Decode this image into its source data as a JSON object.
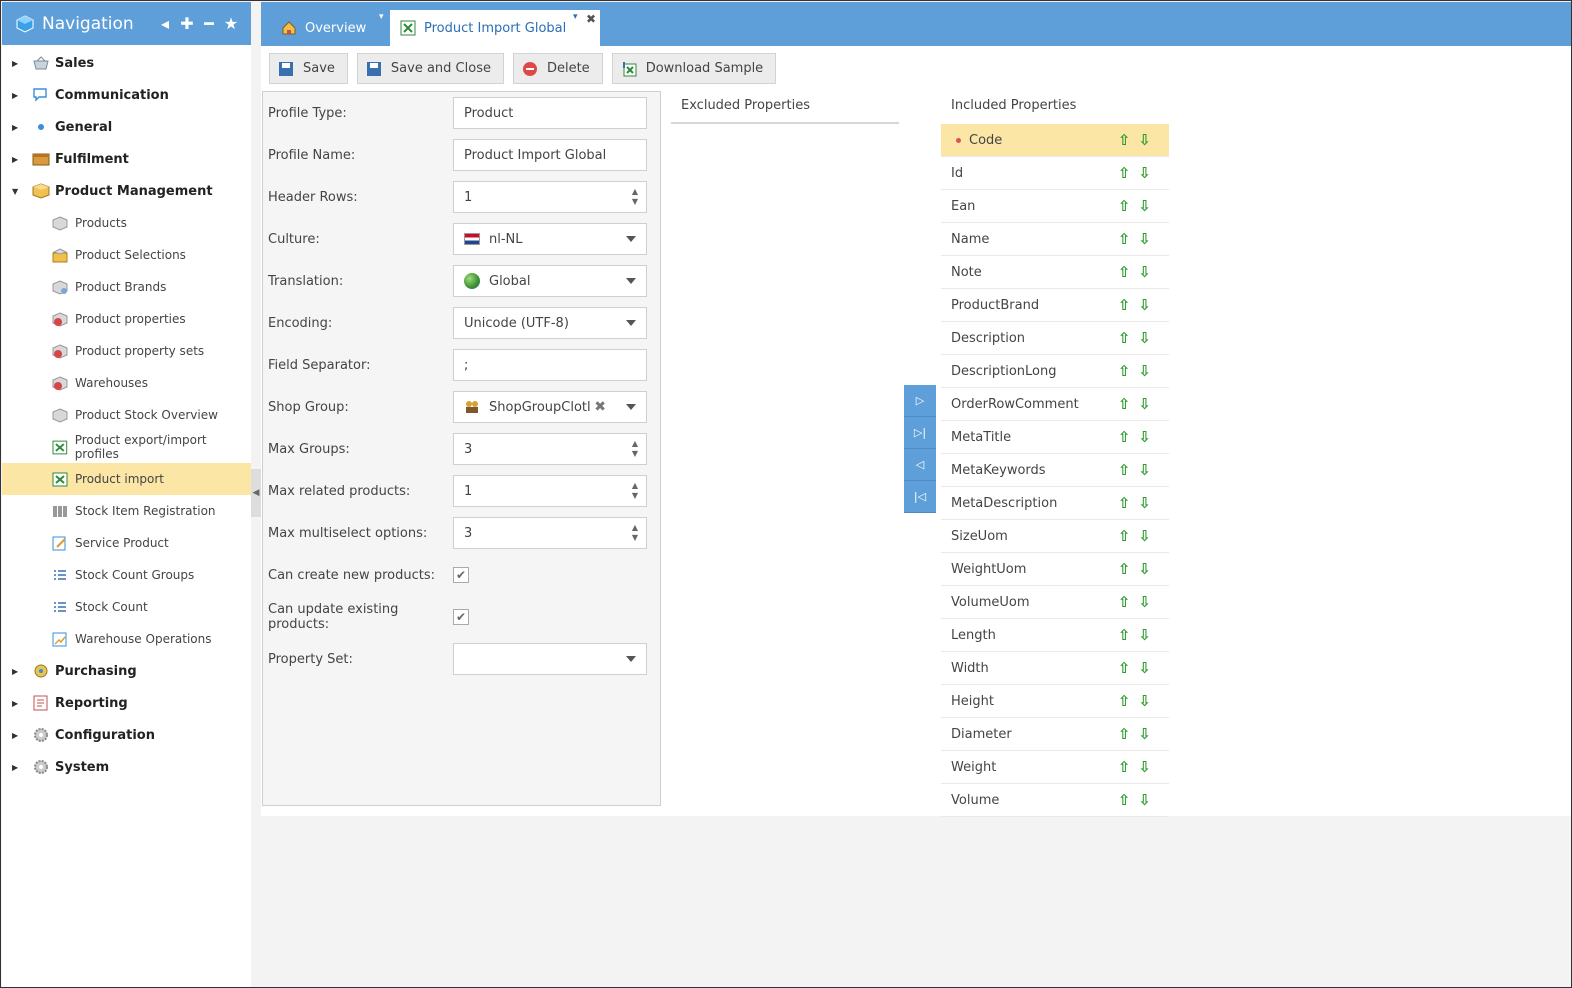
{
  "navigation": {
    "title": "Navigation",
    "groups": [
      {
        "label": "Sales",
        "expanded": false,
        "icon": "basket-icon"
      },
      {
        "label": "Communication",
        "expanded": false,
        "icon": "chat-icon"
      },
      {
        "label": "General",
        "expanded": false,
        "icon": "dot-icon"
      },
      {
        "label": "Fulfilment",
        "expanded": false,
        "icon": "box-icon"
      },
      {
        "label": "Product Management",
        "expanded": true,
        "icon": "package-icon"
      },
      {
        "label": "Purchasing",
        "expanded": false,
        "icon": "purchase-icon"
      },
      {
        "label": "Reporting",
        "expanded": false,
        "icon": "report-icon"
      },
      {
        "label": "Configuration",
        "expanded": false,
        "icon": "gear-icon"
      },
      {
        "label": "System",
        "expanded": false,
        "icon": "gear-icon"
      }
    ],
    "product_management_items": [
      {
        "label": "Products"
      },
      {
        "label": "Product Selections"
      },
      {
        "label": "Product Brands"
      },
      {
        "label": "Product properties"
      },
      {
        "label": "Product property sets"
      },
      {
        "label": "Warehouses"
      },
      {
        "label": "Product Stock Overview"
      },
      {
        "label": "Product export/import profiles"
      },
      {
        "label": "Product import",
        "active": true
      },
      {
        "label": "Stock Item Registration"
      },
      {
        "label": "Service Product"
      },
      {
        "label": "Stock Count Groups"
      },
      {
        "label": "Stock Count"
      },
      {
        "label": "Warehouse Operations"
      }
    ]
  },
  "tabs": [
    {
      "label": "Overview"
    },
    {
      "label": "Product Import Global",
      "active": true
    }
  ],
  "toolbar": {
    "save": "Save",
    "save_close": "Save and Close",
    "delete": "Delete",
    "download_sample": "Download Sample"
  },
  "form": {
    "profile_type_label": "Profile Type:",
    "profile_type": "Product",
    "profile_name_label": "Profile Name:",
    "profile_name": "Product Import Global",
    "header_rows_label": "Header Rows:",
    "header_rows": "1",
    "culture_label": "Culture:",
    "culture": "nl-NL",
    "translation_label": "Translation:",
    "translation": "Global",
    "encoding_label": "Encoding:",
    "encoding": "Unicode (UTF-8)",
    "field_separator_label": "Field Separator:",
    "field_separator": ";",
    "shop_group_label": "Shop Group:",
    "shop_group": "ShopGroupClotl",
    "max_groups_label": "Max Groups:",
    "max_groups": "3",
    "max_related_label": "Max related products:",
    "max_related": "1",
    "max_multiselect_label": "Max multiselect options:",
    "max_multiselect": "3",
    "can_create_label": "Can create new products:",
    "can_create": true,
    "can_update_label": "Can update existing products:",
    "can_update": true,
    "property_set_label": "Property Set:",
    "property_set": ""
  },
  "excluded": {
    "title": "Excluded Properties"
  },
  "included": {
    "title": "Included Properties",
    "items": [
      "Code",
      "Id",
      "Ean",
      "Name",
      "Note",
      "ProductBrand",
      "Description",
      "DescriptionLong",
      "OrderRowComment",
      "MetaTitle",
      "MetaKeywords",
      "MetaDescription",
      "SizeUom",
      "WeightUom",
      "VolumeUom",
      "Length",
      "Width",
      "Height",
      "Diameter",
      "Weight",
      "Volume"
    ]
  },
  "colors": {
    "accent": "#5f9fd9",
    "selected": "#fbe6a5",
    "arrow": "#2b9a2b"
  }
}
